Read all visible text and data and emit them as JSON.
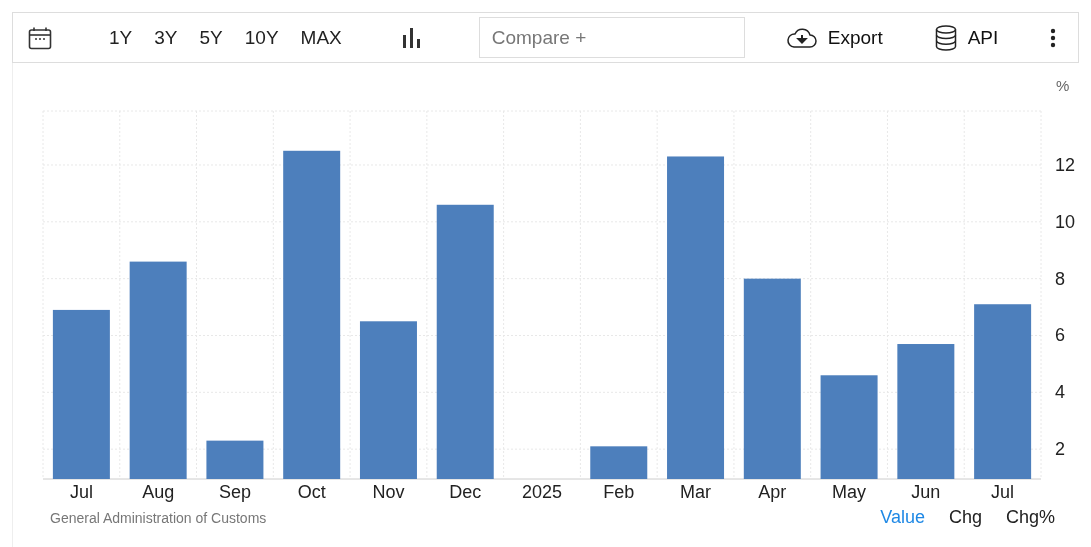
{
  "toolbar": {
    "ranges": [
      {
        "label": "1Y",
        "selected": false
      },
      {
        "label": "3Y",
        "selected": false
      },
      {
        "label": "5Y",
        "selected": false
      },
      {
        "label": "10Y",
        "selected": false
      },
      {
        "label": "MAX",
        "selected": false
      }
    ],
    "compare": {
      "placeholder": "Compare +"
    },
    "export": "Export",
    "api": "API"
  },
  "chart": {
    "unit": "%",
    "chart_data": {
      "type": "bar",
      "categories": [
        "Jul",
        "Aug",
        "Sep",
        "Oct",
        "Nov",
        "Dec",
        "2025",
        "Feb",
        "Mar",
        "Apr",
        "May",
        "Jun",
        "Jul"
      ],
      "grid": true,
      "series": [
        {
          "color": "#4d7fbc",
          "values": [
            6.9,
            8.6,
            2.3,
            12.5,
            6.5,
            10.6,
            null,
            2.1,
            12.3,
            8.0,
            4.6,
            5.7,
            7.1
          ]
        }
      ],
      "ylim": [
        0.95,
        13.9
      ],
      "yticks": [
        2,
        4,
        6,
        8,
        10,
        12
      ]
    }
  },
  "footer": {
    "source": "General Administration of Customs",
    "tabs": [
      {
        "label": "Value",
        "selected": true
      },
      {
        "label": "Chg",
        "selected": false
      },
      {
        "label": "Chg%",
        "selected": false
      }
    ]
  }
}
